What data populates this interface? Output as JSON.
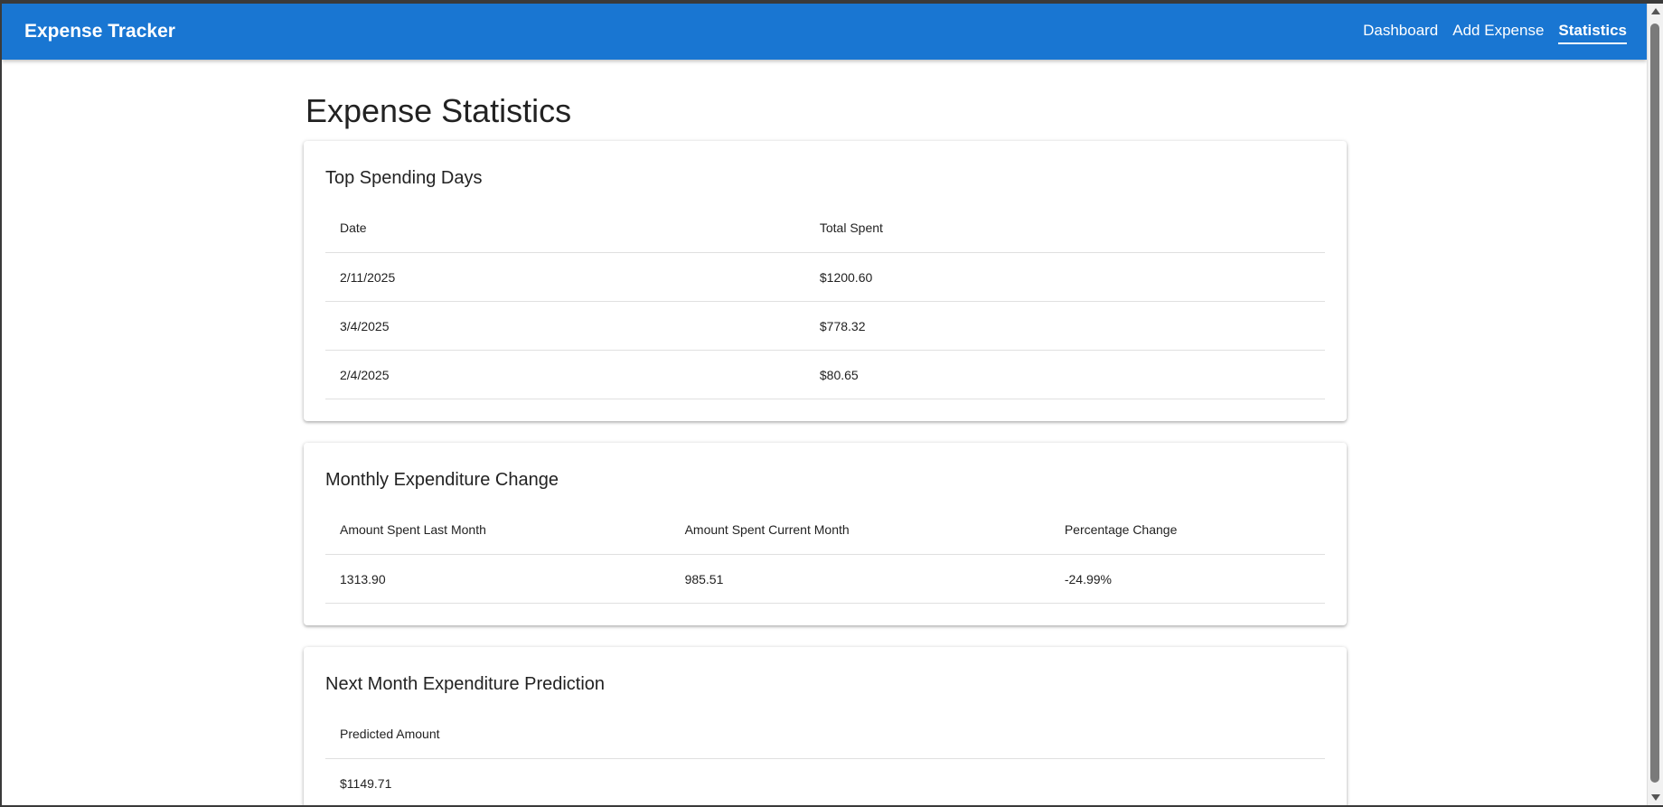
{
  "appbar": {
    "title": "Expense Tracker",
    "nav": [
      {
        "label": "Dashboard",
        "active": false
      },
      {
        "label": "Add Expense",
        "active": false
      },
      {
        "label": "Statistics",
        "active": true
      }
    ],
    "color": "#1976d2"
  },
  "page": {
    "title": "Expense Statistics"
  },
  "top_spending": {
    "title": "Top Spending Days",
    "columns": [
      "Date",
      "Total Spent"
    ],
    "rows": [
      [
        "2/11/2025",
        "$1200.60"
      ],
      [
        "3/4/2025",
        "$778.32"
      ],
      [
        "2/4/2025",
        "$80.65"
      ]
    ]
  },
  "monthly_change": {
    "title": "Monthly Expenditure Change",
    "columns": [
      "Amount Spent Last Month",
      "Amount Spent Current Month",
      "Percentage Change"
    ],
    "rows": [
      [
        "1313.90",
        "985.51",
        "-24.99%"
      ]
    ]
  },
  "prediction": {
    "title": "Next Month Expenditure Prediction",
    "columns": [
      "Predicted Amount"
    ],
    "rows": [
      [
        "$1149.71"
      ]
    ]
  }
}
